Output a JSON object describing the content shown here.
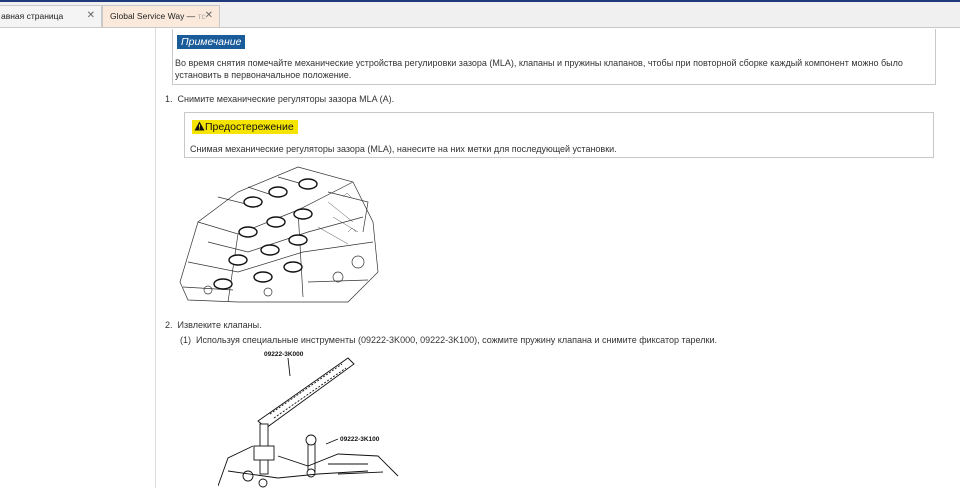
{
  "tabs": [
    {
      "label": "авная страница",
      "active": false
    },
    {
      "label": "Global Service Way — ",
      "label_fade": "тс",
      "active": true
    }
  ],
  "note": {
    "label": "Примечание",
    "text": "Во время снятия помечайте механические устройства регулировки зазора (MLA), клапаны и пружины клапанов, чтобы при повторной сборке каждый компонент можно было установить в первоначальное положение."
  },
  "steps": [
    {
      "number": "1.",
      "text": "Снимите механические регуляторы зазора MLA (A)."
    },
    {
      "number": "2.",
      "text": "Извлеките клапаны."
    }
  ],
  "caution": {
    "label": "Предостережение",
    "text": "Снимая механические регуляторы зазора (MLA), нанесите на них метки для последующей установки."
  },
  "substep": {
    "number": "(1)",
    "text": "Используя специальные инструменты (09222-3K000, 09222-3K100), сожмите пружину клапана и снимите фиксатор тарелки."
  },
  "figure2": {
    "label_top": "09222-3K000",
    "label_side": "09222-3K100"
  },
  "icons": {
    "close": "close-icon",
    "caution": "warning-triangle-icon"
  },
  "colors": {
    "note_label_bg": "#1a5b99",
    "caution_label_bg": "#f5e400",
    "active_tab_bg": "#fbeadc"
  }
}
